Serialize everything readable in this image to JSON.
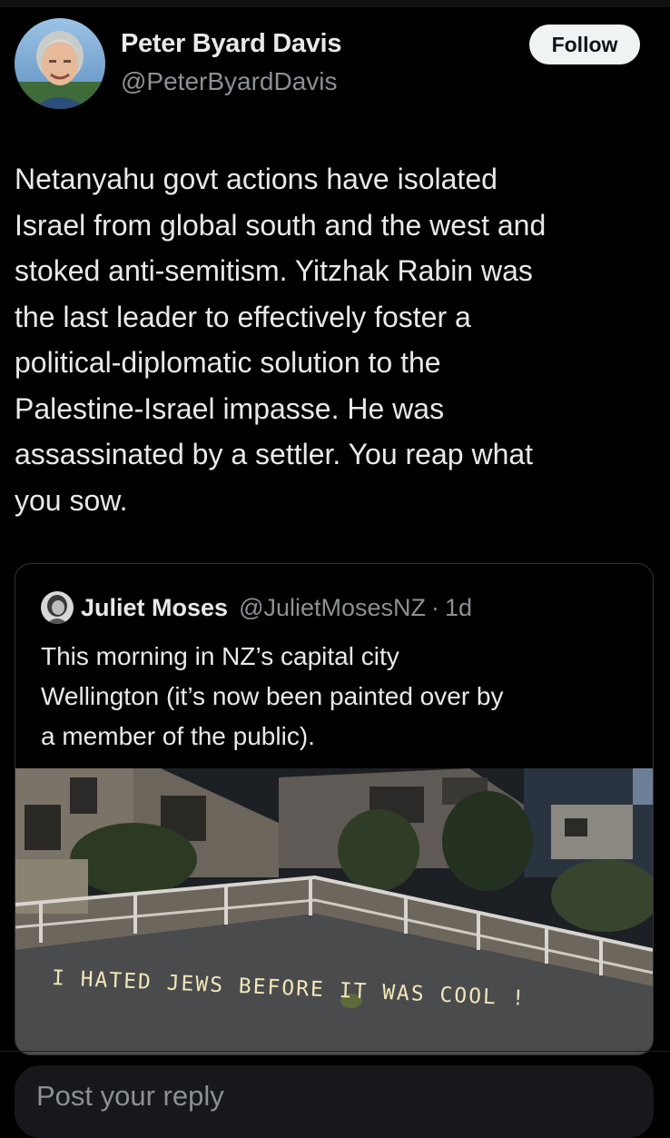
{
  "author": {
    "name": "Peter Byard Davis",
    "handle": "@PeterByardDavis",
    "follow_label": "Follow",
    "avatar_icon": "profile-photo-icon"
  },
  "post": {
    "text": "Netanyahu govt actions have isolated\nIsrael from global south and the west and\nstoked anti-semitism. Yitzhak Rabin was\nthe last leader to effectively foster a\npolitical-diplomatic solution to the\nPalestine-Israel impasse. He was\nassassinated by a settler. You reap what\nyou sow."
  },
  "quoted": {
    "name": "Juliet Moses",
    "handle": "@JulietMosesNZ",
    "dot": "·",
    "time": "1d",
    "text": "This morning in NZ’s capital city\nWellington (it’s now been painted over by\na member of the public).",
    "image": {
      "graffiti_text": "I HATED JEWS BEFORE IT WAS COOL !"
    }
  },
  "reply": {
    "placeholder": "Post your reply"
  },
  "colors": {
    "background": "#000000",
    "text": "#e7e9ea",
    "secondary_text": "#8b9096",
    "follow_button_bg": "#eff3f4",
    "border": "#2f3336"
  }
}
